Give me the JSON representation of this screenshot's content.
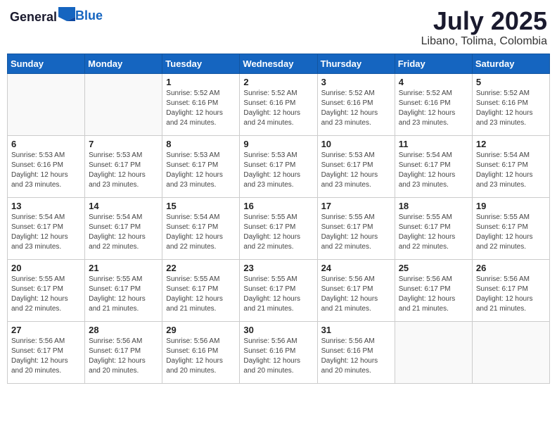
{
  "header": {
    "logo_general": "General",
    "logo_blue": "Blue",
    "month_year": "July 2025",
    "location": "Libano, Tolima, Colombia"
  },
  "days_of_week": [
    "Sunday",
    "Monday",
    "Tuesday",
    "Wednesday",
    "Thursday",
    "Friday",
    "Saturday"
  ],
  "weeks": [
    [
      {
        "day": "",
        "info": ""
      },
      {
        "day": "",
        "info": ""
      },
      {
        "day": "1",
        "info": "Sunrise: 5:52 AM\nSunset: 6:16 PM\nDaylight: 12 hours and 24 minutes."
      },
      {
        "day": "2",
        "info": "Sunrise: 5:52 AM\nSunset: 6:16 PM\nDaylight: 12 hours and 24 minutes."
      },
      {
        "day": "3",
        "info": "Sunrise: 5:52 AM\nSunset: 6:16 PM\nDaylight: 12 hours and 23 minutes."
      },
      {
        "day": "4",
        "info": "Sunrise: 5:52 AM\nSunset: 6:16 PM\nDaylight: 12 hours and 23 minutes."
      },
      {
        "day": "5",
        "info": "Sunrise: 5:52 AM\nSunset: 6:16 PM\nDaylight: 12 hours and 23 minutes."
      }
    ],
    [
      {
        "day": "6",
        "info": "Sunrise: 5:53 AM\nSunset: 6:16 PM\nDaylight: 12 hours and 23 minutes."
      },
      {
        "day": "7",
        "info": "Sunrise: 5:53 AM\nSunset: 6:17 PM\nDaylight: 12 hours and 23 minutes."
      },
      {
        "day": "8",
        "info": "Sunrise: 5:53 AM\nSunset: 6:17 PM\nDaylight: 12 hours and 23 minutes."
      },
      {
        "day": "9",
        "info": "Sunrise: 5:53 AM\nSunset: 6:17 PM\nDaylight: 12 hours and 23 minutes."
      },
      {
        "day": "10",
        "info": "Sunrise: 5:53 AM\nSunset: 6:17 PM\nDaylight: 12 hours and 23 minutes."
      },
      {
        "day": "11",
        "info": "Sunrise: 5:54 AM\nSunset: 6:17 PM\nDaylight: 12 hours and 23 minutes."
      },
      {
        "day": "12",
        "info": "Sunrise: 5:54 AM\nSunset: 6:17 PM\nDaylight: 12 hours and 23 minutes."
      }
    ],
    [
      {
        "day": "13",
        "info": "Sunrise: 5:54 AM\nSunset: 6:17 PM\nDaylight: 12 hours and 23 minutes."
      },
      {
        "day": "14",
        "info": "Sunrise: 5:54 AM\nSunset: 6:17 PM\nDaylight: 12 hours and 22 minutes."
      },
      {
        "day": "15",
        "info": "Sunrise: 5:54 AM\nSunset: 6:17 PM\nDaylight: 12 hours and 22 minutes."
      },
      {
        "day": "16",
        "info": "Sunrise: 5:55 AM\nSunset: 6:17 PM\nDaylight: 12 hours and 22 minutes."
      },
      {
        "day": "17",
        "info": "Sunrise: 5:55 AM\nSunset: 6:17 PM\nDaylight: 12 hours and 22 minutes."
      },
      {
        "day": "18",
        "info": "Sunrise: 5:55 AM\nSunset: 6:17 PM\nDaylight: 12 hours and 22 minutes."
      },
      {
        "day": "19",
        "info": "Sunrise: 5:55 AM\nSunset: 6:17 PM\nDaylight: 12 hours and 22 minutes."
      }
    ],
    [
      {
        "day": "20",
        "info": "Sunrise: 5:55 AM\nSunset: 6:17 PM\nDaylight: 12 hours and 22 minutes."
      },
      {
        "day": "21",
        "info": "Sunrise: 5:55 AM\nSunset: 6:17 PM\nDaylight: 12 hours and 21 minutes."
      },
      {
        "day": "22",
        "info": "Sunrise: 5:55 AM\nSunset: 6:17 PM\nDaylight: 12 hours and 21 minutes."
      },
      {
        "day": "23",
        "info": "Sunrise: 5:55 AM\nSunset: 6:17 PM\nDaylight: 12 hours and 21 minutes."
      },
      {
        "day": "24",
        "info": "Sunrise: 5:56 AM\nSunset: 6:17 PM\nDaylight: 12 hours and 21 minutes."
      },
      {
        "day": "25",
        "info": "Sunrise: 5:56 AM\nSunset: 6:17 PM\nDaylight: 12 hours and 21 minutes."
      },
      {
        "day": "26",
        "info": "Sunrise: 5:56 AM\nSunset: 6:17 PM\nDaylight: 12 hours and 21 minutes."
      }
    ],
    [
      {
        "day": "27",
        "info": "Sunrise: 5:56 AM\nSunset: 6:17 PM\nDaylight: 12 hours and 20 minutes."
      },
      {
        "day": "28",
        "info": "Sunrise: 5:56 AM\nSunset: 6:17 PM\nDaylight: 12 hours and 20 minutes."
      },
      {
        "day": "29",
        "info": "Sunrise: 5:56 AM\nSunset: 6:16 PM\nDaylight: 12 hours and 20 minutes."
      },
      {
        "day": "30",
        "info": "Sunrise: 5:56 AM\nSunset: 6:16 PM\nDaylight: 12 hours and 20 minutes."
      },
      {
        "day": "31",
        "info": "Sunrise: 5:56 AM\nSunset: 6:16 PM\nDaylight: 12 hours and 20 minutes."
      },
      {
        "day": "",
        "info": ""
      },
      {
        "day": "",
        "info": ""
      }
    ]
  ]
}
